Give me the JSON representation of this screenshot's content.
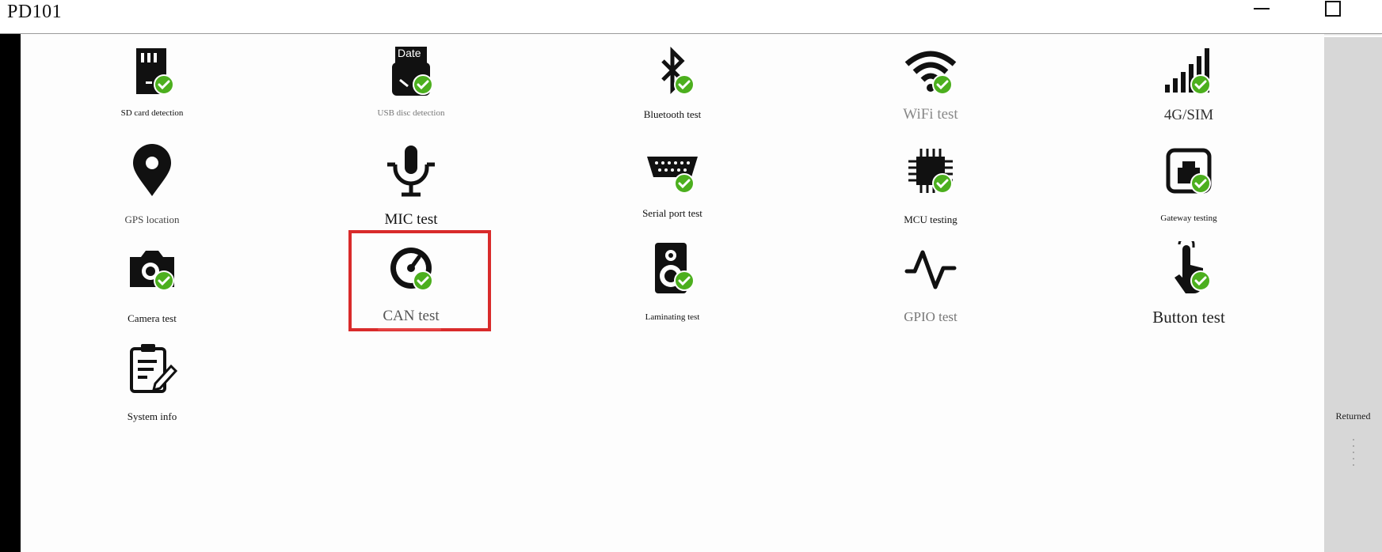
{
  "window": {
    "title": "PD101"
  },
  "side_panel": {
    "returned_label": "Returned"
  },
  "colors": {
    "check_green": "#4caf1e",
    "highlight_red": "#d92b2b",
    "panel_gray": "#d7d7d7"
  },
  "tests": [
    {
      "label": "SD card detection",
      "icon": "sd-card-icon",
      "checked": true
    },
    {
      "label": "USB disc detection",
      "icon": "usb-disc-icon",
      "icon_text": "Date",
      "checked": true
    },
    {
      "label": "Bluetooth test",
      "icon": "bluetooth-icon",
      "checked": true
    },
    {
      "label": "WiFi test",
      "icon": "wifi-icon",
      "checked": true
    },
    {
      "label": "4G/SIM",
      "icon": "signal-bars-icon",
      "checked": true
    },
    {
      "label": "GPS location",
      "icon": "location-pin-icon",
      "checked": false
    },
    {
      "label": "MIC test",
      "icon": "microphone-icon",
      "checked": false
    },
    {
      "label": "Serial port  test",
      "icon": "serial-port-icon",
      "checked": true
    },
    {
      "label": "MCU testing",
      "icon": "chip-icon",
      "checked": true
    },
    {
      "label": "Gateway testing",
      "icon": "gateway-icon",
      "checked": true
    },
    {
      "label": "Camera test",
      "icon": "camera-icon",
      "checked": true
    },
    {
      "label": "CAN test",
      "icon": "gauge-icon",
      "checked": true,
      "selected": true
    },
    {
      "label": "Laminating test",
      "icon": "speaker-icon",
      "checked": true
    },
    {
      "label": "GPIO test",
      "icon": "waveform-icon",
      "checked": false
    },
    {
      "label": "Button test",
      "icon": "touch-hand-icon",
      "checked": true
    },
    {
      "label": "System info",
      "icon": "clipboard-edit-icon",
      "checked": false
    }
  ]
}
